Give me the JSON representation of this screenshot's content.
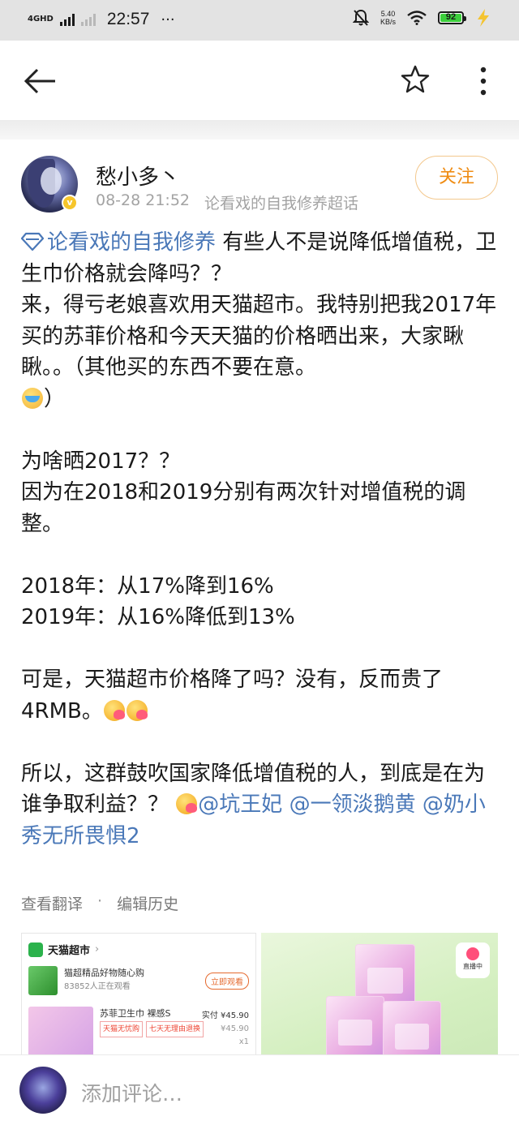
{
  "status_bar": {
    "network": "4GHD",
    "time": "22:57",
    "dots": "···",
    "speed_value": "5.40",
    "speed_unit": "KB/s",
    "battery": "92"
  },
  "post": {
    "username": "愁小多丶",
    "date": "08-28 21:52",
    "source": "论看戏的自我修养超话",
    "follow_label": "关注",
    "topic": "论看戏的自我修养",
    "p1_rest": " 有些人不是说降低增值税，卫生巾价格就会降吗？？",
    "p2": "来，得亏老娘喜欢用天猫超市。我特别把我2017年买的苏菲价格和今天天猫的价格晒出来，大家瞅瞅。。（其他买的东西不要在意。",
    "p2_end": "）",
    "p3": "为啥晒2017？？",
    "p4": "因为在2018和2019分别有两次针对增值税的调整。",
    "p5": "2018年：从17%降到16%",
    "p6": "2019年：从16%降低到13%",
    "p7": "可是，天猫超市价格降了吗？没有，反而贵了4RMB。",
    "p8": "所以，这群鼓吹国家降低增值税的人，到底是在为谁争取利益？？",
    "mention1": "@坑王妃",
    "mention2": "@一领淡鹅黄",
    "mention3": "@奶小秀无所畏惧2",
    "translate": "查看翻译",
    "separator": "·",
    "history": "编辑历史"
  },
  "image1": {
    "store": "天猫超市",
    "chevron": "›",
    "live_title": "猫超精品好物随心购",
    "viewers": "83852人正在观看",
    "watch_btn": "立即观看",
    "product": "苏菲卫生巾 裸感S",
    "tag1": "天猫无忧购",
    "tag2": "七天无理由退换",
    "price_label": "实付 ¥45.90",
    "price2": "¥45.90",
    "qty": "x1"
  },
  "image2": {
    "live_label": "直播中"
  },
  "comment_bar": {
    "placeholder": "添加评论…"
  }
}
